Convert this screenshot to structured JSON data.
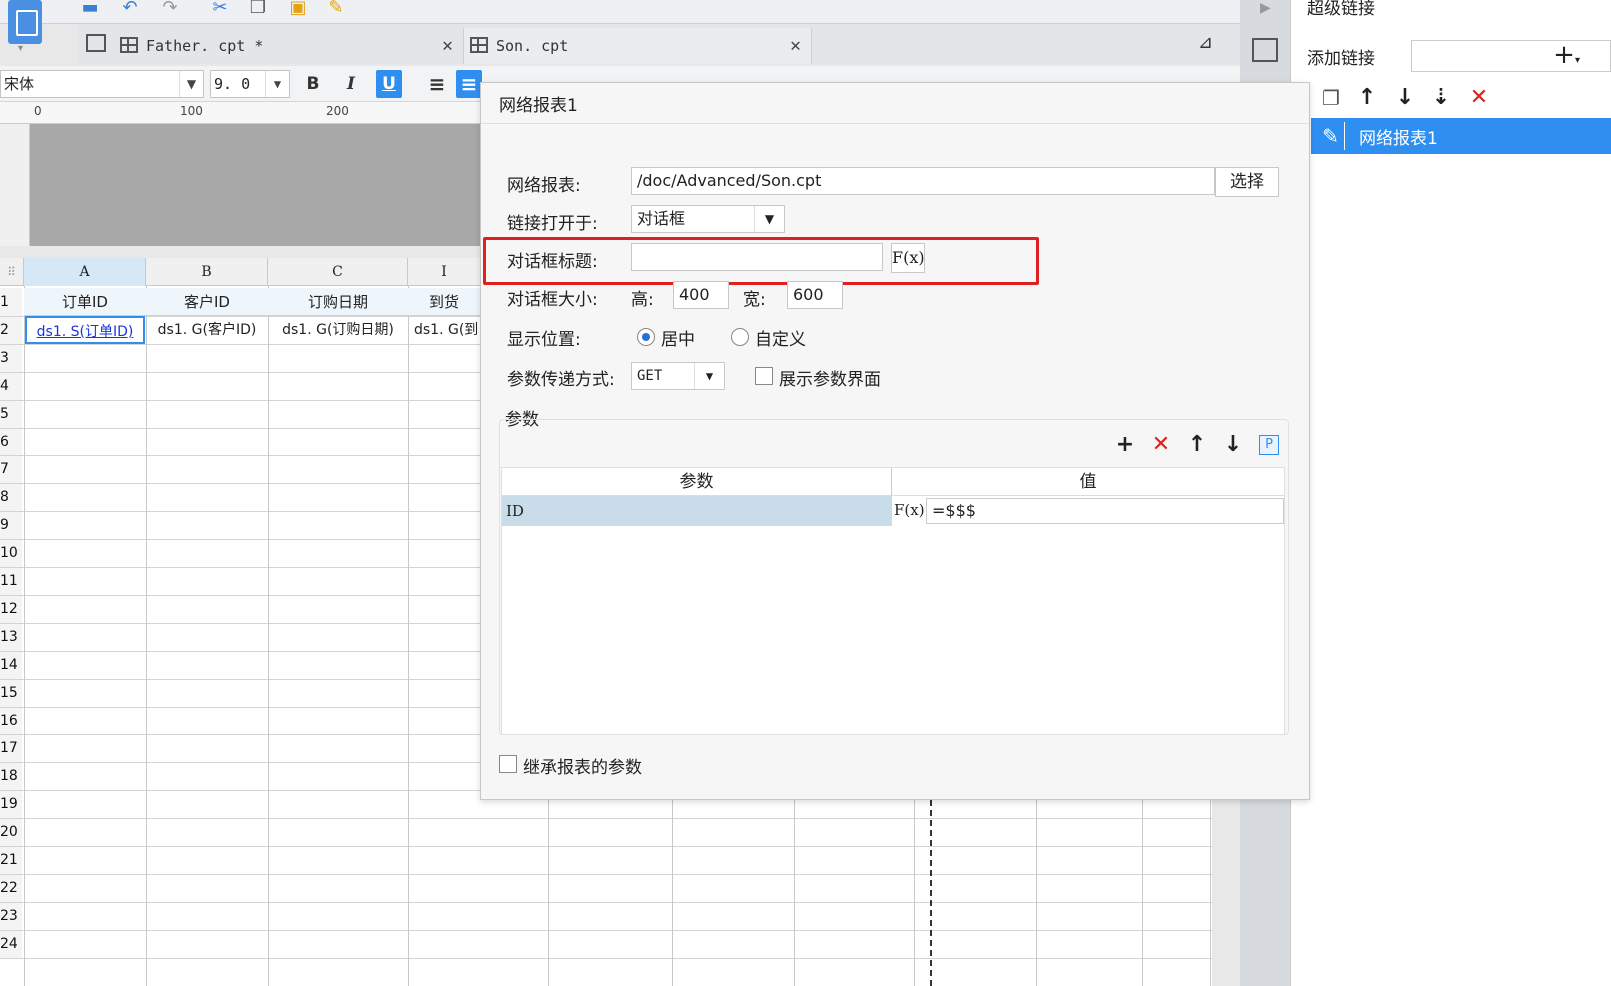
{
  "tabs": [
    {
      "label": "Father. cpt *"
    },
    {
      "label": "Son. cpt"
    }
  ],
  "format": {
    "font": "宋体",
    "size": "9. 0",
    "bold": "B",
    "italic": "I",
    "underline": "U"
  },
  "ruler": {
    "t0": "0",
    "t100": "100",
    "t200": "200"
  },
  "columns": [
    "A",
    "B",
    "C",
    "I"
  ],
  "rows": [
    "1",
    "2",
    "3",
    "4",
    "5",
    "6",
    "7",
    "8",
    "9",
    "10",
    "11",
    "12",
    "13",
    "14",
    "15",
    "16",
    "17",
    "18",
    "19",
    "20",
    "21",
    "22",
    "23",
    "24"
  ],
  "cells": {
    "a1": "订单ID",
    "b1": "客户ID",
    "c1": "订购日期",
    "d1": "到货",
    "a2": "ds1. S(订单ID)",
    "b2": "ds1. G(客户ID)",
    "c2": "ds1. G(订购日期)",
    "d2": "ds1. G(到"
  },
  "dialog": {
    "title": "网络报表1",
    "report_label": "网络报表:",
    "report_value": "/doc/Advanced/Son.cpt",
    "select_button": "选择",
    "open_in_label": "链接打开于:",
    "open_in_value": "对话框",
    "dialog_title_label": "对话框标题:",
    "dialog_title_value": "",
    "fx": "F(x)",
    "size_label": "对话框大小:",
    "height_label": "高:",
    "height_value": "400",
    "width_label": "宽:",
    "width_value": "600",
    "position_label": "显示位置:",
    "center_label": "居中",
    "custom_label": "自定义",
    "param_method_label": "参数传递方式:",
    "param_method_value": "GET",
    "show_params_label": "展示参数界面",
    "params_group_label": "参数",
    "p_btn": "P",
    "table_headers": [
      "参数",
      "值"
    ],
    "params": [
      {
        "name": "ID",
        "value": "=$$$"
      }
    ],
    "inherit_label": "继承报表的参数"
  },
  "rpanel": {
    "title": "超级链接",
    "add_label": "添加链接",
    "add_btn": "+",
    "items": [
      "网络报表1"
    ]
  },
  "colors": {
    "accent": "#2f8ff0",
    "highlight": "#e02020",
    "selected_row": "#c8dcea"
  }
}
